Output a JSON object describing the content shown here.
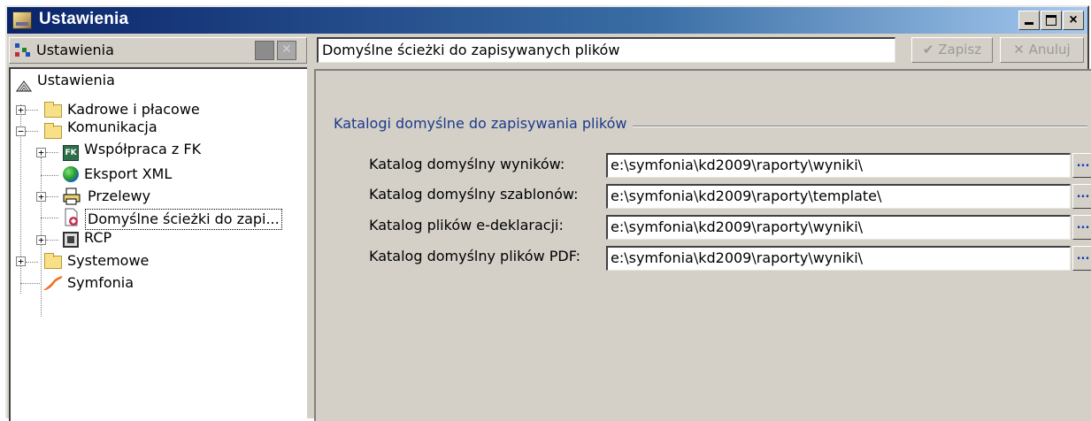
{
  "window": {
    "title": "Ustawienia",
    "controls": {
      "minimize": "_",
      "maximize": "□",
      "close": "×"
    }
  },
  "left_header": {
    "label": "Ustawienia"
  },
  "tree": {
    "root": "Ustawienia",
    "items": [
      {
        "label": "Kadrowe i płacowe",
        "expander": "+"
      },
      {
        "label": "Komunikacja",
        "expander": "−"
      },
      {
        "label": "Współpraca z FK",
        "expander": "+",
        "badge": "FK"
      },
      {
        "label": "Eksport XML"
      },
      {
        "label": "Przelewy",
        "expander": "+"
      },
      {
        "label": "Domyślne ścieżki do zapi..."
      },
      {
        "label": "RCP",
        "expander": "+"
      },
      {
        "label": "Systemowe",
        "expander": "+"
      },
      {
        "label": "Symfonia"
      }
    ]
  },
  "header": {
    "path": "Domyślne ścieżki do zapisywanych plików",
    "save_label": "Zapisz",
    "save_icon": "✔",
    "cancel_label": "Anuluj",
    "cancel_icon": "✕"
  },
  "group": {
    "title": "Katalogi domyślne do zapisywania plików",
    "fields": [
      {
        "label": "Katalog domyślny wyników:",
        "value": "e:\\symfonia\\kd2009\\raporty\\wyniki\\"
      },
      {
        "label": "Katalog domyślny szablonów:",
        "value": "e:\\symfonia\\kd2009\\raporty\\template\\"
      },
      {
        "label": "Katalog plików e-deklaracji:",
        "value": "e:\\symfonia\\kd2009\\raporty\\wyniki\\"
      },
      {
        "label": "Katalog domyślny plików PDF:",
        "value": "e:\\symfonia\\kd2009\\raporty\\wyniki\\"
      }
    ],
    "browse_label": "..."
  }
}
